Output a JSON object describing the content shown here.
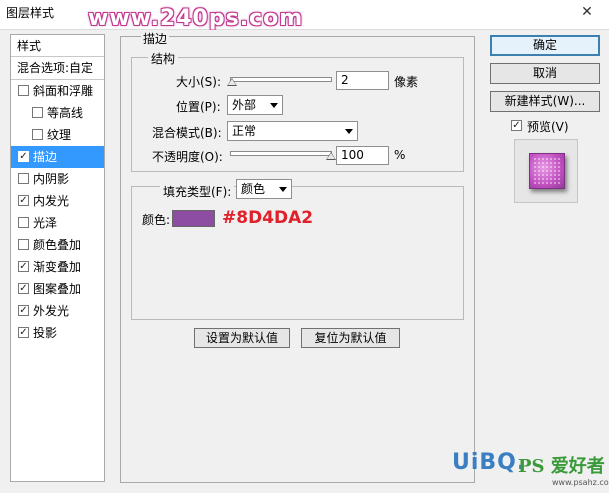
{
  "window": {
    "title": "图层样式",
    "close_glyph": "✕",
    "watermark": "www.240ps.com"
  },
  "left_list": {
    "header": "样式",
    "blend_options": "混合选项:自定",
    "items": [
      {
        "label": "斜面和浮雕",
        "checked": false,
        "sub": false
      },
      {
        "label": "等高线",
        "checked": false,
        "sub": true
      },
      {
        "label": "纹理",
        "checked": false,
        "sub": true
      },
      {
        "label": "描边",
        "checked": true,
        "sub": false,
        "selected": true
      },
      {
        "label": "内阴影",
        "checked": false,
        "sub": false
      },
      {
        "label": "内发光",
        "checked": true,
        "sub": false
      },
      {
        "label": "光泽",
        "checked": false,
        "sub": false
      },
      {
        "label": "颜色叠加",
        "checked": false,
        "sub": false
      },
      {
        "label": "渐变叠加",
        "checked": true,
        "sub": false
      },
      {
        "label": "图案叠加",
        "checked": true,
        "sub": false
      },
      {
        "label": "外发光",
        "checked": true,
        "sub": false
      },
      {
        "label": "投影",
        "checked": true,
        "sub": false
      }
    ]
  },
  "stroke": {
    "title": "描边",
    "structure": {
      "title": "结构",
      "size_label": "大小(S):",
      "size_value": "2",
      "size_unit": "像素",
      "size_level": 0.02,
      "position_label": "位置(P):",
      "position_value": "外部",
      "blend_label": "混合模式(B):",
      "blend_value": "正常",
      "opacity_label": "不透明度(O):",
      "opacity_value": "100",
      "opacity_unit": "%",
      "opacity_level": 1.0
    },
    "fill": {
      "type_label": "填充类型(F):",
      "type_value": "颜色",
      "color_label": "颜色:",
      "color_hex": "#8D4DA2",
      "color_text": "#8D4DA2"
    },
    "set_default": "设置为默认值",
    "reset_default": "复位为默认值"
  },
  "buttons": {
    "ok": "确定",
    "cancel": "取消",
    "new_style": "新建样式(W)...",
    "preview_label": "预览(V)",
    "preview_checked": true
  },
  "branding": {
    "logo": "UiBQ.",
    "logo_ps": "PS 爱好者",
    "logo_sub": "www.psahz.com"
  }
}
